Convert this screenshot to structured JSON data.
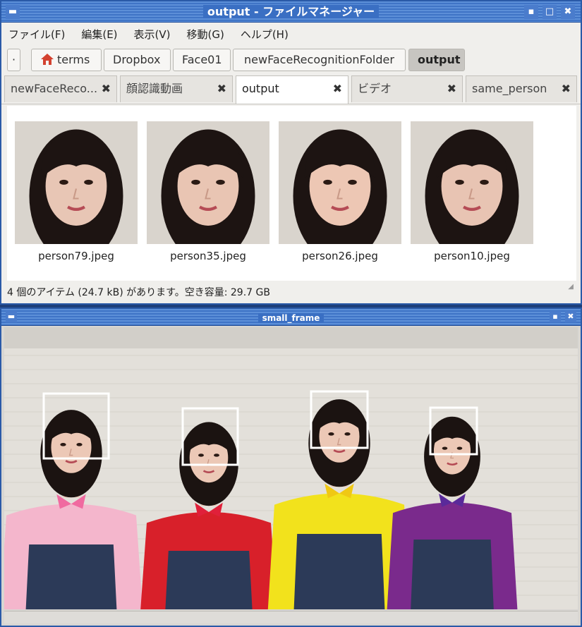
{
  "file_manager": {
    "title": "output - ファイルマネージャー",
    "menu": [
      "ファイル(F)",
      "編集(E)",
      "表示(V)",
      "移動(G)",
      "ヘルプ(H)"
    ],
    "breadcrumb": [
      "·",
      "terms",
      "Dropbox",
      "Face01",
      "newFaceRecognitionFolder",
      "output"
    ],
    "tabs": [
      {
        "label": "newFaceReco...",
        "close": "✖"
      },
      {
        "label": "顔認識動画",
        "close": "✖"
      },
      {
        "label": "output",
        "close": "✖"
      },
      {
        "label": "ビデオ",
        "close": "✖"
      },
      {
        "label": "same_person",
        "close": "✖"
      }
    ],
    "files": [
      {
        "name": "person79.jpeg",
        "shirt": "#c62a3c",
        "skin": "#e8c6b5"
      },
      {
        "name": "person35.jpeg",
        "shirt": "#c08860",
        "skin": "#e9c5b3"
      },
      {
        "name": "person26.jpeg",
        "shirt": "#d13a4a",
        "skin": "#edc7b4"
      },
      {
        "name": "person10.jpeg",
        "shirt": "#5a3a8e",
        "skin": "#e8c4b3"
      }
    ],
    "status": "4 個のアイテム (24.7 kB) があります。空き容量: 29.7 GB",
    "colors": {
      "titlebar": "#3f74c6",
      "accent": "#2a5aa8"
    }
  },
  "small_frame": {
    "title": "small_frame",
    "people": [
      {
        "shirt": "#f4b6cc",
        "bow": "#f06aa0"
      },
      {
        "shirt": "#d8202a",
        "bow": "#e0203a"
      },
      {
        "shirt": "#f2e21c",
        "bow": "#f0c814"
      },
      {
        "shirt": "#7a2a8c",
        "bow": "#5a2a9a"
      }
    ],
    "face_box_color": "#ffffff"
  }
}
